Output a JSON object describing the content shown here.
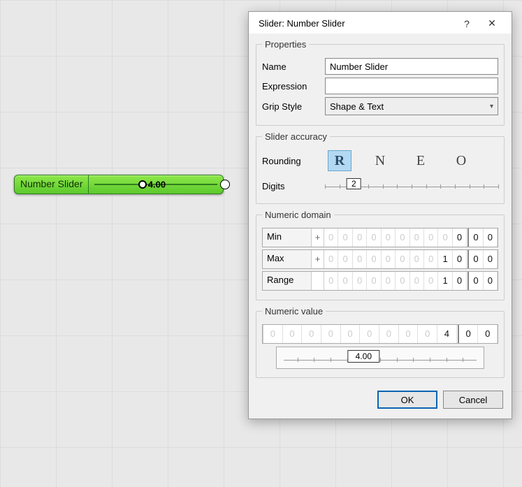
{
  "canvas": {
    "slider_label": "Number Slider",
    "slider_value": "4.00"
  },
  "dialog": {
    "title": "Slider: Number Slider",
    "help_label": "?",
    "close_label": "✕",
    "properties": {
      "legend": "Properties",
      "name_label": "Name",
      "name_value": "Number Slider",
      "expression_label": "Expression",
      "expression_value": "",
      "grip_label": "Grip Style",
      "grip_value": "Shape & Text"
    },
    "accuracy": {
      "legend": "Slider accuracy",
      "rounding_label": "Rounding",
      "rounding_options": [
        "R",
        "N",
        "E",
        "O"
      ],
      "rounding_selected": "R",
      "digits_label": "Digits",
      "digits_value": "2"
    },
    "domain": {
      "legend": "Numeric domain",
      "min_label": "Min",
      "min_sign": "+",
      "min_digits": [
        "0",
        "0",
        "0",
        "0",
        "0",
        "0",
        "0",
        "0",
        "0",
        "0",
        ".",
        "0",
        "0"
      ],
      "min_active": [
        false,
        false,
        false,
        false,
        false,
        false,
        false,
        false,
        false,
        true,
        true,
        true,
        true
      ],
      "max_label": "Max",
      "max_sign": "+",
      "max_digits": [
        "0",
        "0",
        "0",
        "0",
        "0",
        "0",
        "0",
        "0",
        "1",
        "0",
        ".",
        "0",
        "0"
      ],
      "max_active": [
        false,
        false,
        false,
        false,
        false,
        false,
        false,
        false,
        true,
        true,
        true,
        true,
        true
      ],
      "range_label": "Range",
      "range_digits": [
        "0",
        "0",
        "0",
        "0",
        "0",
        "0",
        "0",
        "0",
        "1",
        "0",
        ".",
        "0",
        "0"
      ],
      "range_active": [
        false,
        false,
        false,
        false,
        false,
        false,
        false,
        false,
        true,
        true,
        true,
        true,
        true
      ]
    },
    "value": {
      "legend": "Numeric value",
      "digits": [
        "0",
        "0",
        "0",
        "0",
        "0",
        "0",
        "0",
        "0",
        "0",
        "4",
        ".",
        "0",
        "0"
      ],
      "active": [
        false,
        false,
        false,
        false,
        false,
        false,
        false,
        false,
        false,
        true,
        true,
        true,
        true
      ],
      "slider_display": "4.00"
    },
    "buttons": {
      "ok": "OK",
      "cancel": "Cancel"
    }
  }
}
